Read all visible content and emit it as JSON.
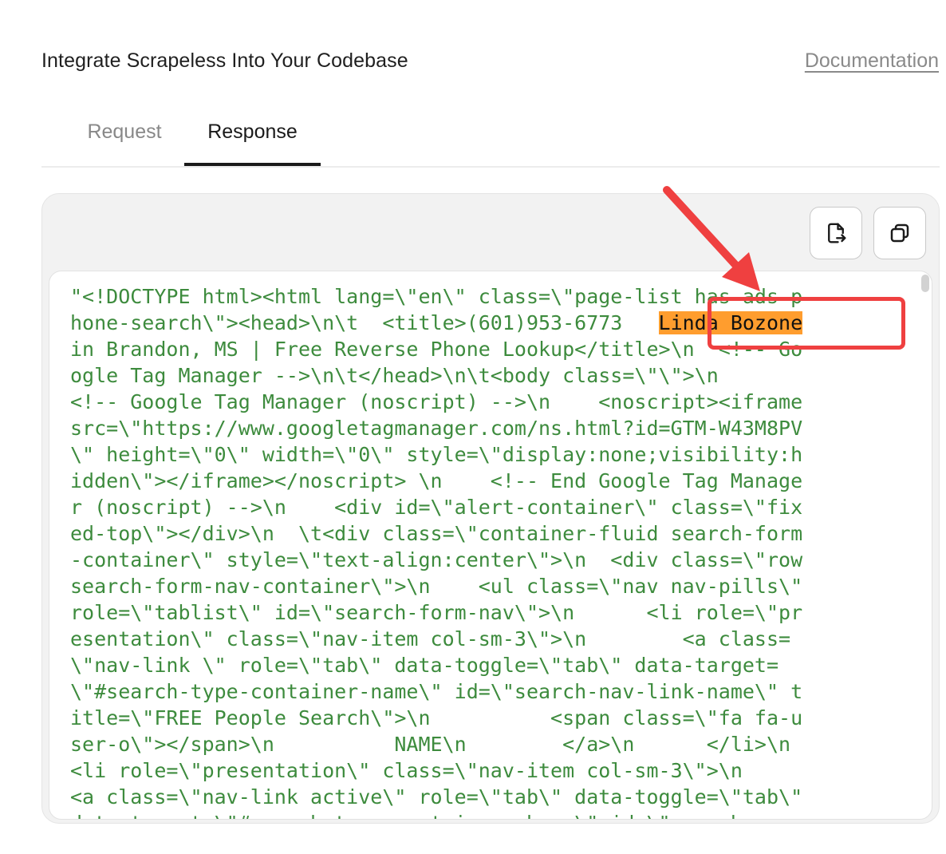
{
  "header": {
    "title": "Integrate Scrapeless Into Your Codebase",
    "documentation_link": "Documentation"
  },
  "tabs": [
    {
      "label": "Request",
      "active": false
    },
    {
      "label": "Response",
      "active": true
    }
  ],
  "toolbar": {
    "export_icon": "file-export-icon",
    "copy_icon": "copy-icon"
  },
  "code": {
    "highlight_text": "Linda Bozone",
    "highlight_color": "#ff9d2e",
    "text_color": "#3d8b3d",
    "lines": [
      "\"<!DOCTYPE html><html lang=\\\"en\\\" class=\\\"page-list has-ads p",
      "hone-search\\\"><head>\\n\\t  <title>(601)953-6773   ",
      "in Brandon, MS | Free Reverse Phone Lookup</title>\\n  <!-- Go",
      "ogle Tag Manager -->\\n\\t</head>\\n\\t<body class=\\\"\\\">\\n",
      "<!-- Google Tag Manager (noscript) -->\\n    <noscript><iframe",
      "src=\\\"https://www.googletagmanager.com/ns.html?id=GTM-W43M8PV",
      "\\\" height=\\\"0\\\" width=\\\"0\\\" style=\\\"display:none;visibility:h",
      "idden\\\"></iframe></noscript> \\n    <!-- End Google Tag Manage",
      "r (noscript) -->\\n    <div id=\\\"alert-container\\\" class=\\\"fix",
      "ed-top\\\"></div>\\n  \\t<div class=\\\"container-fluid search-form",
      "-container\\\" style=\\\"text-align:center\\\">\\n  <div class=\\\"row",
      "search-form-nav-container\\\">\\n    <ul class=\\\"nav nav-pills\\\"",
      "role=\\\"tablist\\\" id=\\\"search-form-nav\\\">\\n      <li role=\\\"pr",
      "esentation\\\" class=\\\"nav-item col-sm-3\\\">\\n        <a class=",
      "\\\"nav-link \\\" role=\\\"tab\\\" data-toggle=\\\"tab\\\" data-target=",
      "\\\"#search-type-container-name\\\" id=\\\"search-nav-link-name\\\" t",
      "itle=\\\"FREE People Search\\\">\\n          <span class=\\\"fa fa-u",
      "ser-o\\\"></span>\\n          NAME\\n        </a>\\n      </li>\\n",
      "<li role=\\\"presentation\\\" class=\\\"nav-item col-sm-3\\\">\\n",
      "<a class=\\\"nav-link active\\\" role=\\\"tab\\\" data-toggle=\\\"tab\\\"",
      "data-target=\\\"#search-type-container-phone\\\" id=\\\"search-nav"
    ]
  },
  "annotation": {
    "box_color": "#ef4040"
  }
}
